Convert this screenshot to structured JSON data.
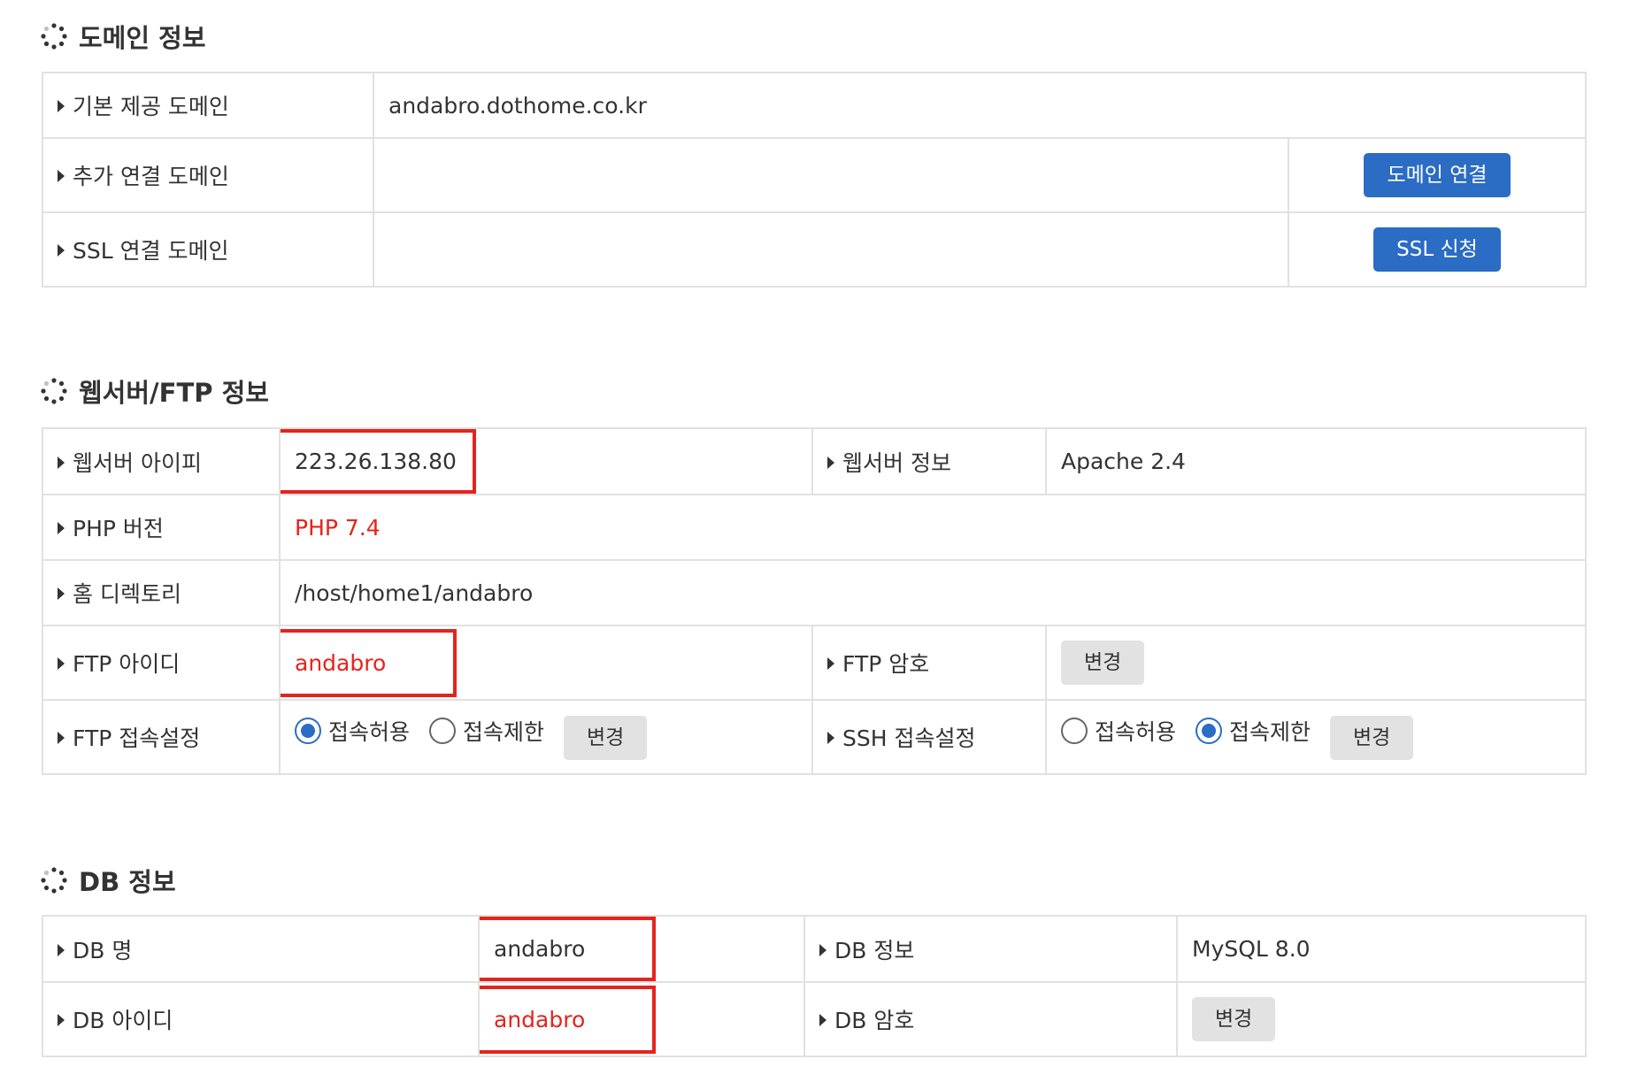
{
  "domain_section": {
    "title": "도메인 정보",
    "rows": [
      {
        "label": "기본 제공 도메인",
        "value": "andabro.dothome.co.kr"
      },
      {
        "label": "추가 연결 도메인",
        "button": "도메인 연결"
      },
      {
        "label": "SSL 연결 도메인",
        "button": "SSL 신청"
      }
    ]
  },
  "web_section": {
    "title": "웹서버/FTP 정보",
    "ip_label": "웹서버 아이피",
    "ip_value": "223.26.138.80",
    "server_label": "웹서버 정보",
    "server_value": "Apache 2.4",
    "php_label": "PHP 버전",
    "php_value": "PHP 7.4",
    "home_label": "홈 디렉토리",
    "home_value": "/host/home1/andabro",
    "ftp_id_label": "FTP 아이디",
    "ftp_id_value": "andabro",
    "ftp_pw_label": "FTP 암호",
    "ftp_pw_button": "변경",
    "ftp_access_label": "FTP 접속설정",
    "ftp_allow": "접속허용",
    "ftp_deny": "접속제한",
    "ftp_access_button": "변경",
    "ftp_selected": "allow",
    "ssh_access_label": "SSH 접속설정",
    "ssh_allow": "접속허용",
    "ssh_deny": "접속제한",
    "ssh_access_button": "변경",
    "ssh_selected": "deny"
  },
  "db_section": {
    "title": "DB 정보",
    "name_label": "DB 명",
    "name_value": "andabro",
    "info_label": "DB 정보",
    "info_value": "MySQL 8.0",
    "id_label": "DB 아이디",
    "id_value": "andabro",
    "pw_label": "DB 암호",
    "pw_button": "변경"
  },
  "colors": {
    "accent": "#2b6cc4",
    "highlight": "#e5231d",
    "border": "#e1e1e1"
  }
}
